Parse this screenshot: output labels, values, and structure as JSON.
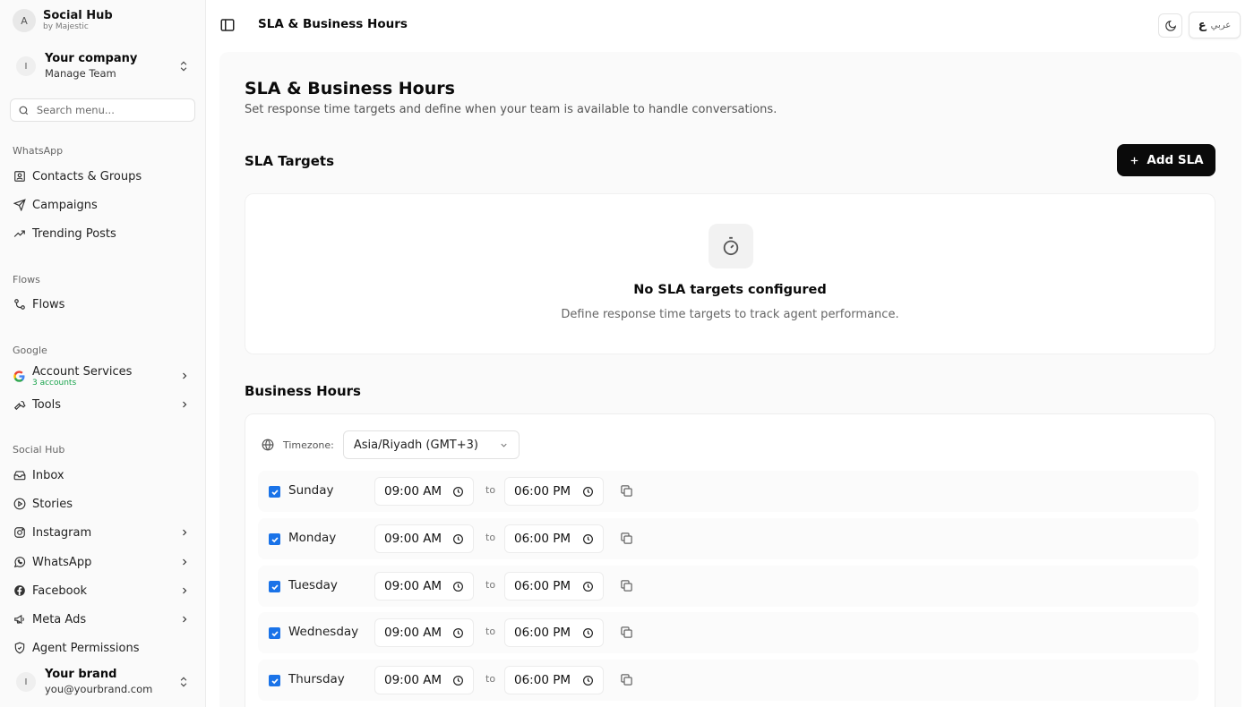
{
  "sidebar": {
    "brand": {
      "avatar": "A",
      "title": "Social Hub",
      "subtitle": "by Majestic"
    },
    "company": {
      "avatar": "I",
      "title": "Your company",
      "subtitle": "Manage Team"
    },
    "search": {
      "placeholder": "Search menu..."
    },
    "sections": {
      "whatsapp": "WhatsApp",
      "flows": "Flows",
      "google": "Google",
      "social_hub": "Social Hub"
    },
    "items": {
      "contacts": "Contacts & Groups",
      "campaigns": "Campaigns",
      "trending": "Trending Posts",
      "flows": "Flows",
      "account_services": "Account Services",
      "account_services_sub": "3 accounts",
      "tools": "Tools",
      "inbox": "Inbox",
      "stories": "Stories",
      "instagram": "Instagram",
      "whatsapp": "WhatsApp",
      "facebook": "Facebook",
      "meta_ads": "Meta Ads",
      "agent_permissions": "Agent Permissions"
    },
    "user": {
      "avatar": "I",
      "name": "Your brand",
      "email": "you@yourbrand.com"
    }
  },
  "topbar": {
    "breadcrumb": "SLA & Business Hours",
    "lang_label": "عربي",
    "lang_glyph": "ع"
  },
  "page": {
    "title": "SLA & Business Hours",
    "description": "Set response time targets and define when your team is available to handle conversations.",
    "sla_heading": "SLA Targets",
    "add_sla_label": "Add SLA",
    "empty_title": "No SLA targets configured",
    "empty_desc": "Define response time targets to track agent performance.",
    "hours_heading": "Business Hours",
    "timezone_label": "Timezone:",
    "timezone_value": "Asia/Riyadh (GMT+3)",
    "to_label": "to",
    "days": [
      {
        "name": "Sunday",
        "enabled": true,
        "start": "09:00 AM",
        "end": "06:00 PM"
      },
      {
        "name": "Monday",
        "enabled": true,
        "start": "09:00 AM",
        "end": "06:00 PM"
      },
      {
        "name": "Tuesday",
        "enabled": true,
        "start": "09:00 AM",
        "end": "06:00 PM"
      },
      {
        "name": "Wednesday",
        "enabled": true,
        "start": "09:00 AM",
        "end": "06:00 PM"
      },
      {
        "name": "Thursday",
        "enabled": true,
        "start": "09:00 AM",
        "end": "06:00 PM"
      }
    ]
  },
  "colors": {
    "accent": "#0a0a0a",
    "checkbox": "#1a73e8",
    "success": "#16a34a"
  }
}
